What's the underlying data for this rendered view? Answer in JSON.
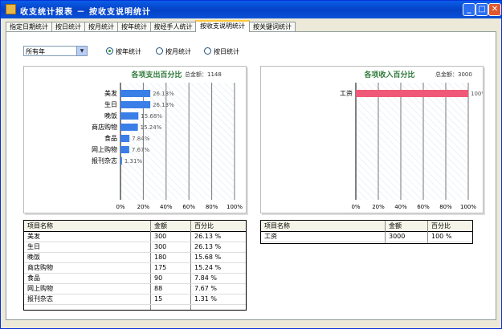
{
  "window": {
    "title": "收支统计报表 － 按收支说明统计"
  },
  "tabs": [
    {
      "label": "指定日期统计"
    },
    {
      "label": "按日统计"
    },
    {
      "label": "按月统计"
    },
    {
      "label": "按年统计"
    },
    {
      "label": "按经手人统计"
    },
    {
      "label": "按收支说明统计"
    },
    {
      "label": "按关键词统计"
    }
  ],
  "active_tab": "按收支说明统计",
  "filter": {
    "year_select": "所有年"
  },
  "radios": [
    {
      "label": "按年统计",
      "checked": true
    },
    {
      "label": "按月统计",
      "checked": false
    },
    {
      "label": "按日统计",
      "checked": false
    }
  ],
  "colors": {
    "expense_bar": "#3a7ee8",
    "income_bar": "#f05878",
    "title_green": "#2f7a3a"
  },
  "chart_data": [
    {
      "type": "bar",
      "orientation": "horizontal",
      "title": "各项支出百分比",
      "subtitle": "总金额：1148",
      "categories": [
        "美发",
        "生日",
        "晚饭",
        "商店购物",
        "食品",
        "网上购物",
        "报刊杂志"
      ],
      "values": [
        26.13,
        26.13,
        15.68,
        15.24,
        7.84,
        7.67,
        1.31
      ],
      "value_labels": [
        "26.13%",
        "26.13%",
        "15.68%",
        "15.24%",
        "7.84%",
        "7.67%",
        "1.31%"
      ],
      "xlim": [
        0,
        100
      ],
      "xticks": [
        "0%",
        "20%",
        "40%",
        "60%",
        "80%",
        "100%"
      ],
      "grid": true
    },
    {
      "type": "bar",
      "orientation": "horizontal",
      "title": "各项收入百分比",
      "subtitle": "总金额：3000",
      "categories": [
        "工资"
      ],
      "values": [
        100
      ],
      "value_labels": [
        "100%"
      ],
      "xlim": [
        0,
        100
      ],
      "xticks": [
        "0%",
        "20%",
        "40%",
        "60%",
        "80%",
        "100%"
      ],
      "grid": true
    }
  ],
  "expense_table": {
    "headers": [
      "项目名称",
      "金额",
      "百分比"
    ],
    "rows": [
      [
        "美发",
        "300",
        "26.13 %"
      ],
      [
        "生日",
        "300",
        "26.13 %"
      ],
      [
        "晚饭",
        "180",
        "15.68 %"
      ],
      [
        "商店购物",
        "175",
        "15.24 %"
      ],
      [
        "食品",
        "90",
        "7.84 %"
      ],
      [
        "网上购物",
        "88",
        "7.67 %"
      ],
      [
        "报刊杂志",
        "15",
        "1.31 %"
      ]
    ]
  },
  "income_table": {
    "headers": [
      "项目名称",
      "金额",
      "百分比"
    ],
    "rows": [
      [
        "工资",
        "3000",
        "100 %"
      ]
    ]
  }
}
